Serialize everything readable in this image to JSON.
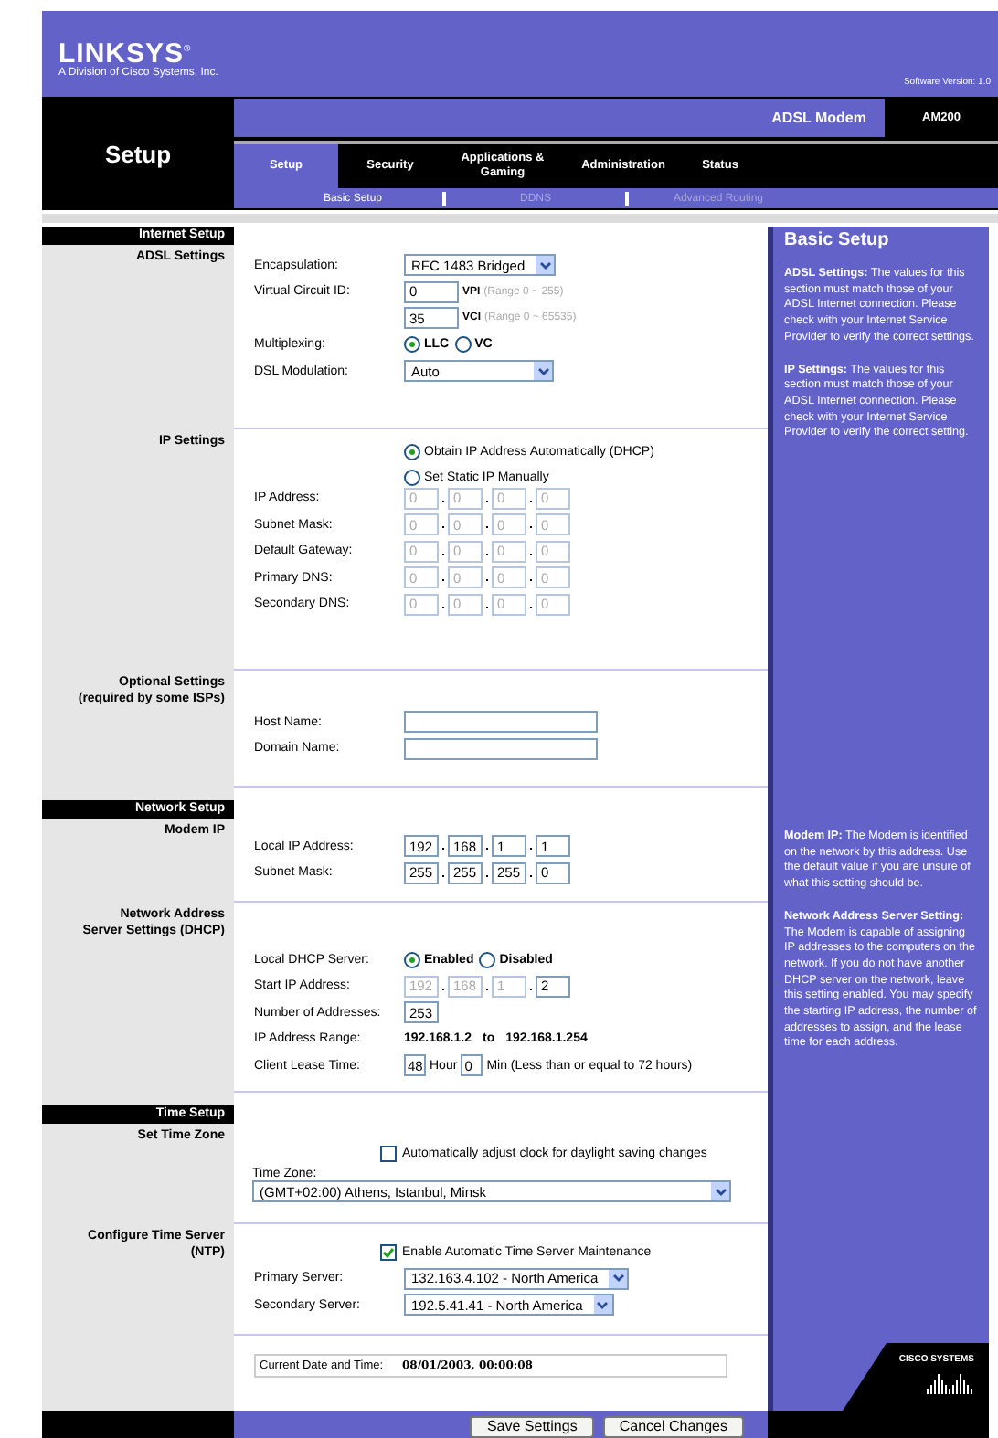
{
  "header": {
    "logo": "LINKSYS",
    "logo_mark": "®",
    "tagline": "A Division of Cisco Systems, Inc.",
    "software_version": "Software Version: 1.0"
  },
  "page_title": "Setup",
  "product": "ADSL Modem",
  "model": "AM200",
  "tabs": [
    {
      "label": "Setup",
      "selected": true
    },
    {
      "label": "Security",
      "selected": false
    },
    {
      "label": "Applications & Gaming",
      "selected": false
    },
    {
      "label": "Administration",
      "selected": false
    },
    {
      "label": "Status",
      "selected": false
    }
  ],
  "subtabs": [
    {
      "label": "Basic Setup",
      "selected": true
    },
    {
      "label": "DDNS",
      "selected": false
    },
    {
      "label": "Advanced Routing",
      "selected": false
    }
  ],
  "groups": [
    {
      "title": "Internet Setup",
      "help": {
        "title": "Basic Setup",
        "paragraphs": [
          "**ADSL Settings:** The values for this section must match those of your ADSL Internet connection. Please check with your Internet Service Provider to verify the correct settings.",
          "**IP Settings:** The values for this section must match those of your ADSL Internet connection. Please check with your Internet Service Provider to verify the correct setting."
        ]
      },
      "sections": [
        {
          "label": [
            "ADSL Settings"
          ],
          "rows": [
            {
              "kind": "select",
              "label": "Encapsulation:",
              "value": "RFC 1483 Bridged"
            },
            {
              "kind": "circuit",
              "label": "Virtual Circuit ID:",
              "value": "0",
              "unit": "VPI",
              "hint": "(Range 0 ~ 255)"
            },
            {
              "kind": "circuit",
              "value": "35",
              "unit": "VCI",
              "hint": "(Range 0 ~ 65535)"
            },
            {
              "kind": "radio-inline",
              "label": "Multiplexing:",
              "options": [
                {
                  "label": "LLC",
                  "selected": true
                },
                {
                  "label": "VC",
                  "selected": false
                }
              ]
            },
            {
              "kind": "select",
              "label": "DSL Modulation:",
              "value": "Auto"
            }
          ]
        },
        {
          "label": [
            "IP Settings"
          ],
          "rows": [
            {
              "kind": "radio-stack",
              "options": [
                {
                  "label": "Obtain IP Address Automatically (DHCP)",
                  "selected": true
                },
                {
                  "label": "Set Static IP Manually",
                  "selected": false
                }
              ]
            },
            {
              "kind": "ip",
              "label": "IP Address:",
              "octets": [
                {
                  "value": "0",
                  "disabled": true
                },
                {
                  "value": "0",
                  "disabled": true
                },
                {
                  "value": "0",
                  "disabled": true
                },
                {
                  "value": "0",
                  "disabled": true
                }
              ]
            },
            {
              "kind": "ip",
              "label": "Subnet Mask:",
              "octets": [
                {
                  "value": "0",
                  "disabled": true
                },
                {
                  "value": "0",
                  "disabled": true
                },
                {
                  "value": "0",
                  "disabled": true
                },
                {
                  "value": "0",
                  "disabled": true
                }
              ]
            },
            {
              "kind": "ip",
              "label": "Default Gateway:",
              "octets": [
                {
                  "value": "0",
                  "disabled": true
                },
                {
                  "value": "0",
                  "disabled": true
                },
                {
                  "value": "0",
                  "disabled": true
                },
                {
                  "value": "0",
                  "disabled": true
                }
              ]
            },
            {
              "kind": "ip",
              "label": "Primary DNS:",
              "octets": [
                {
                  "value": "0",
                  "disabled": true
                },
                {
                  "value": "0",
                  "disabled": true
                },
                {
                  "value": "0",
                  "disabled": true
                },
                {
                  "value": "0",
                  "disabled": true
                }
              ]
            },
            {
              "kind": "ip",
              "label": "Secondary DNS:",
              "octets": [
                {
                  "value": "0",
                  "disabled": true
                },
                {
                  "value": "0",
                  "disabled": true
                },
                {
                  "value": "0",
                  "disabled": true
                },
                {
                  "value": "0",
                  "disabled": true
                }
              ]
            }
          ]
        },
        {
          "label": [
            "Optional Settings",
            "(required by some ISPs)"
          ],
          "rows": [
            {
              "kind": "text",
              "label": "Host Name:"
            },
            {
              "kind": "text",
              "label": "Domain Name:"
            }
          ]
        }
      ]
    },
    {
      "title": "Network Setup",
      "help": {
        "paragraphs": [
          "**Modem IP:** The Modem is identified on the network by this address. Use the default value if you are unsure of what this setting should be.",
          "**Network Address Server Setting:** The Modem is capable of assigning IP addresses to the computers on the network. If you do not have another DHCP server on the network, leave this setting enabled. You may specify the starting IP address, the number of addresses to assign, and the lease time for each address."
        ]
      },
      "sections": [
        {
          "label": [
            "Modem IP"
          ],
          "rows": [
            {
              "kind": "ip",
              "label": "Local IP Address:",
              "octets": [
                {
                  "value": "192",
                  "disabled": false
                },
                {
                  "value": "168",
                  "disabled": false
                },
                {
                  "value": "1",
                  "disabled": false
                },
                {
                  "value": "1",
                  "disabled": false
                }
              ]
            },
            {
              "kind": "ip",
              "label": "Subnet Mask:",
              "octets": [
                {
                  "value": "255",
                  "disabled": false
                },
                {
                  "value": "255",
                  "disabled": false
                },
                {
                  "value": "255",
                  "disabled": false
                },
                {
                  "value": "0",
                  "disabled": false
                }
              ]
            }
          ]
        },
        {
          "label": [
            "Network Address",
            "Server Settings (DHCP)"
          ],
          "rows": [
            {
              "kind": "radio-inline",
              "label": "Local DHCP Server:",
              "options": [
                {
                  "label": "Enabled",
                  "selected": true
                },
                {
                  "label": "Disabled",
                  "selected": false
                }
              ]
            },
            {
              "kind": "ip",
              "label": "Start IP Address:",
              "octets": [
                {
                  "value": "192",
                  "disabled": true
                },
                {
                  "value": "168",
                  "disabled": true
                },
                {
                  "value": "1",
                  "disabled": true
                },
                {
                  "value": "2",
                  "disabled": false
                }
              ]
            },
            {
              "kind": "number",
              "label": "Number of Addresses:",
              "value": "253"
            },
            {
              "kind": "range",
              "label": "IP Address Range:",
              "start": "192.168.1.2",
              "separator": "to",
              "end": "192.168.1.254"
            },
            {
              "kind": "lease",
              "label": "Client Lease Time:",
              "hours": "48",
              "hours_unit": "Hour",
              "minutes": "0",
              "minutes_note": "Min (Less than or equal to 72 hours)"
            }
          ]
        }
      ]
    },
    {
      "title": "Time Setup",
      "sections": [
        {
          "label": [
            "Set Time Zone"
          ],
          "rows": [
            {
              "kind": "checkbox",
              "label": "Automatically adjust clock for daylight saving changes",
              "checked": false
            },
            {
              "kind": "zone",
              "label": "Time Zone:",
              "value": "(GMT+02:00) Athens, Istanbul, Minsk"
            }
          ]
        },
        {
          "label": [
            "Configure Time Server",
            "(NTP)"
          ],
          "rows": [
            {
              "kind": "checkbox",
              "label": "Enable Automatic Time Server Maintenance",
              "checked": true
            },
            {
              "kind": "select",
              "label": "Primary Server:",
              "value": "132.163.4.102 - North America"
            },
            {
              "kind": "select",
              "label": "Secondary Server:",
              "value": "192.5.41.41 - North America"
            }
          ]
        },
        {
          "rows": [
            {
              "kind": "datetime",
              "label": "Current Date and Time:",
              "value": "08/01/2003, 00:00:08"
            }
          ]
        }
      ]
    }
  ],
  "buttons": [
    "Save Settings",
    "Cancel Changes"
  ],
  "footer_logo": "CISCO SYSTEMS"
}
